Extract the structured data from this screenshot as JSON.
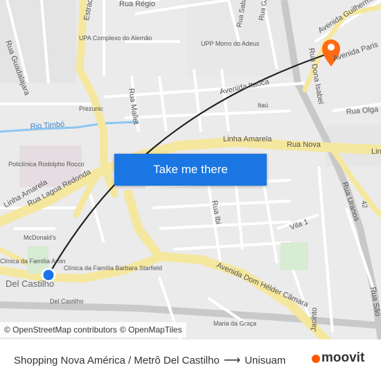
{
  "map": {
    "streets": [
      "Estrada",
      "Rua Régio",
      "Rua Guadalajara",
      "Rua Sabaúna",
      "Rua Gargaú",
      "Avenida Guilherme",
      "Avenida Paris",
      "Avenida Itaóca",
      "Rua Dona Isabel",
      "Rua Olga",
      "Rua Mallet",
      "Linha Amarela",
      "Rua Nova",
      "Rua Lagoa Redonda",
      "Rua Ibi",
      "Rua Uranos",
      "Vila 1",
      "Avenida Dom Hélder Câmara",
      "Rua São",
      "Jacinto",
      "Rio Timbó",
      "Linha",
      "Linha Amarela"
    ],
    "places": [
      "UPA Complexo do Alemão",
      "UPP Morro do Adeus",
      "Prezunic",
      "Itaú",
      "Policlínica Rodolpho Rocco",
      "McDonald's",
      "Clínica da Família Barbara Starfield",
      "Clínica da Família Amin",
      "Del Castilho",
      "Maria da Graça",
      "42"
    ],
    "colors": {
      "origin": "#1a73e8",
      "destination": "#ff6a13",
      "route": "#222222",
      "highway": "#f5e79e",
      "water": "#8cc6f0"
    }
  },
  "cta": {
    "label": "Take me there"
  },
  "attribution": {
    "items": [
      "© OpenStreetMap contributors",
      "© OpenMapTiles"
    ]
  },
  "footer": {
    "from": "Shopping Nova América / Metrô Del Castilho",
    "to": "Unisuam",
    "brand": "moovit"
  }
}
